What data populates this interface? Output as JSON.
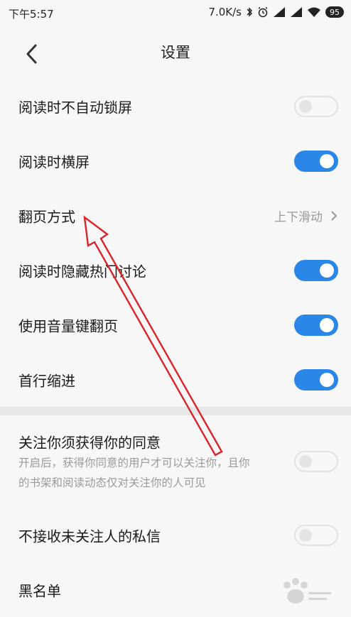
{
  "status_bar": {
    "time": "下午5:57",
    "network_speed": "7.0K/s",
    "battery": "95"
  },
  "header": {
    "title": "设置"
  },
  "settings": {
    "auto_lock": {
      "label": "阅读时不自动锁屏",
      "enabled": false
    },
    "landscape": {
      "label": "阅读时横屏",
      "enabled": true
    },
    "page_turn": {
      "label": "翻页方式",
      "value": "上下滑动"
    },
    "hide_hot": {
      "label": "阅读时隐藏热门讨论",
      "enabled": true
    },
    "volume_keys": {
      "label": "使用音量键翻页",
      "enabled": true
    },
    "indent": {
      "label": "首行缩进",
      "enabled": true
    }
  },
  "privacy": {
    "follow_consent": {
      "label": "关注你须获得你的同意",
      "desc_line1": "开启后，获得你同意的用户才可以关注你，且你",
      "desc_line2": "的书架和阅读动态仅对关注你的人可见",
      "enabled": false
    },
    "reject_messages": {
      "label": "不接收未关注人的私信",
      "enabled": false
    },
    "blacklist": {
      "label": "黑名单"
    }
  },
  "colors": {
    "accent": "#2a87e8",
    "annotation": "#d9242b"
  }
}
